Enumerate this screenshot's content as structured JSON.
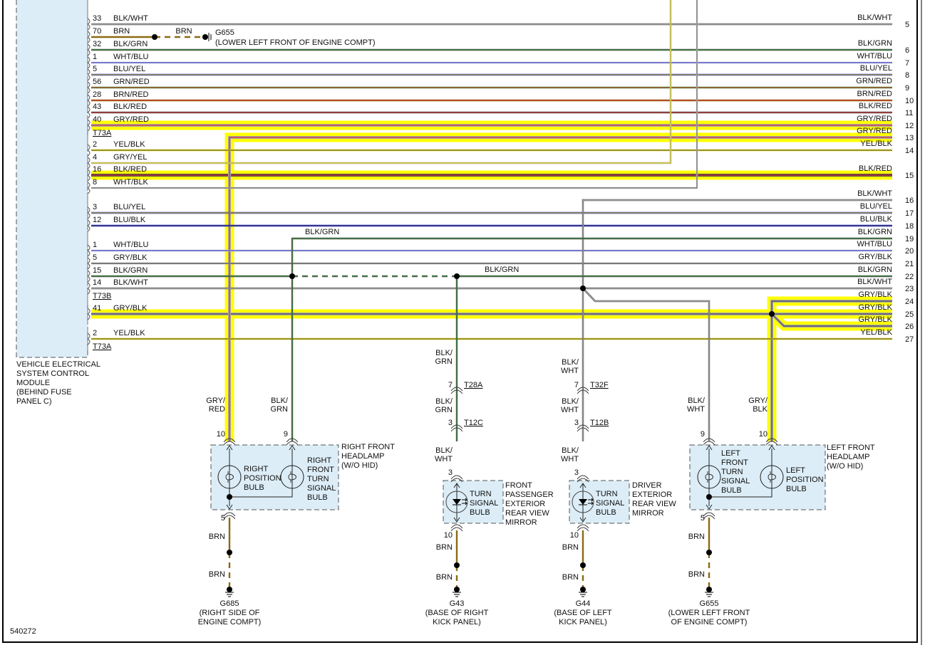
{
  "figure_id": "540272",
  "highlight_color": "#ffff00",
  "wire_colors": {
    "BLK": "#4a4a4a",
    "WHT": "#d0d0d0",
    "BLU": "#2020d0",
    "YEL": "#e6d800",
    "GRN": "#3c9a3c",
    "RED": "#d83030",
    "BRN": "#8b6a14",
    "GRY": "#a8a8a8"
  },
  "module": {
    "name_lines": [
      "VEHICLE ELECTRICAL",
      "SYSTEM CONTROL",
      "MODULE",
      "(BEHIND FUSE",
      "PANEL C)"
    ],
    "connectors": [
      "T73A",
      "T73B",
      "T73A"
    ],
    "pins": [
      {
        "pin": "33",
        "wire": "BLK/WHT"
      },
      {
        "pin": "70",
        "wire": "BRN"
      },
      {
        "pin": "32",
        "wire": "BLK/GRN"
      },
      {
        "pin": "1",
        "wire": "WHT/BLU"
      },
      {
        "pin": "5",
        "wire": "BLU/YEL"
      },
      {
        "pin": "56",
        "wire": "GRN/RED"
      },
      {
        "pin": "28",
        "wire": "BRN/RED"
      },
      {
        "pin": "43",
        "wire": "BLK/RED"
      },
      {
        "pin": "40",
        "wire": "GRY/RED"
      },
      {
        "pin": "2",
        "wire": "YEL/BLK"
      },
      {
        "pin": "4",
        "wire": "GRY/YEL"
      },
      {
        "pin": "16",
        "wire": "BLK/RED"
      },
      {
        "pin": "8",
        "wire": "WHT/BLK"
      },
      {
        "pin": "3",
        "wire": "BLU/YEL"
      },
      {
        "pin": "12",
        "wire": "BLU/BLK"
      },
      {
        "pin": "1",
        "wire": "WHT/BLU"
      },
      {
        "pin": "5",
        "wire": "GRY/BLK"
      },
      {
        "pin": "15",
        "wire": "BLK/GRN"
      },
      {
        "pin": "14",
        "wire": "BLK/WHT"
      },
      {
        "pin": "41",
        "wire": "GRY/BLK"
      },
      {
        "pin": "2",
        "wire": "YEL/BLK"
      }
    ]
  },
  "right_pins": [
    {
      "num": "5",
      "wire": "BLK/WHT"
    },
    {
      "num": "6",
      "wire": "BLK/GRN"
    },
    {
      "num": "7",
      "wire": "WHT/BLU"
    },
    {
      "num": "8",
      "wire": "BLU/YEL"
    },
    {
      "num": "9",
      "wire": "GRN/RED"
    },
    {
      "num": "10",
      "wire": "BRN/RED"
    },
    {
      "num": "11",
      "wire": "BLK/RED"
    },
    {
      "num": "12",
      "wire": "GRY/RED"
    },
    {
      "num": "13",
      "wire": "GRY/RED"
    },
    {
      "num": "14",
      "wire": "YEL/BLK"
    },
    {
      "num": "15",
      "wire": "BLK/RED"
    },
    {
      "num": "16",
      "wire": "BLK/WHT"
    },
    {
      "num": "17",
      "wire": "BLU/YEL"
    },
    {
      "num": "18",
      "wire": "BLU/BLK"
    },
    {
      "num": "19",
      "wire": "BLK/GRN"
    },
    {
      "num": "20",
      "wire": "WHT/BLU"
    },
    {
      "num": "21",
      "wire": "GRY/BLK"
    },
    {
      "num": "22",
      "wire": "BLK/GRN"
    },
    {
      "num": "23",
      "wire": "BLK/WHT"
    },
    {
      "num": "24",
      "wire": "GRY/BLK"
    },
    {
      "num": "25",
      "wire": "GRY/BLK"
    },
    {
      "num": "26",
      "wire": "GRY/BLK"
    },
    {
      "num": "27",
      "wire": "YEL/BLK"
    }
  ],
  "top_ground": {
    "wire": "BRN",
    "id": "G655",
    "location": "(LOWER LEFT FRONT OF ENGINE COMPT)"
  },
  "splice_labels": {
    "blk_grn_19": "BLK/GRN",
    "blk_grn_22": "BLK/GRN"
  },
  "right_headlamp": {
    "title_lines": [
      "RIGHT FRONT",
      "HEADLAMP",
      "(W/O HID)"
    ],
    "bulb1_lines": [
      "RIGHT",
      "POSITION",
      "BULB"
    ],
    "bulb2_lines": [
      "RIGHT",
      "FRONT",
      "TURN",
      "SIGNAL",
      "BULB"
    ],
    "wire1_lines": [
      "GRY/",
      "RED"
    ],
    "wire2_lines": [
      "BLK/",
      "GRN"
    ],
    "pin1": "10",
    "pin2": "9",
    "pin_out": "5",
    "out_wire": "BRN",
    "ground_wire": "BRN",
    "ground_id": "G685",
    "ground_location_lines": [
      "(RIGHT SIDE OF",
      "ENGINE COMPT)"
    ]
  },
  "passenger_mirror": {
    "title_lines": [
      "FRONT",
      "PASSENGER",
      "EXTERIOR",
      "REAR VIEW",
      "MIRROR"
    ],
    "bulb_lines": [
      "TURN",
      "SIGNAL",
      "BULB"
    ],
    "wire_a_lines": [
      "BLK/",
      "GRN"
    ],
    "conn1_pin": "7",
    "conn1": "T28A",
    "wire_b_lines": [
      "BLK/",
      "GRN"
    ],
    "conn2_pin": "3",
    "conn2": "T12C",
    "wire_c_lines": [
      "BLK/",
      "WHT"
    ],
    "pin_in": "3",
    "pin_out": "10",
    "out_wire": "BRN",
    "ground_wire": "BRN",
    "ground_id": "G43",
    "ground_location_lines": [
      "(BASE OF RIGHT",
      "KICK PANEL)"
    ]
  },
  "driver_mirror": {
    "title_lines": [
      "DRIVER",
      "EXTERIOR",
      "REAR VIEW",
      "MIRROR"
    ],
    "bulb_lines": [
      "TURN",
      "SIGNAL",
      "BULB"
    ],
    "wire_a_lines": [
      "BLK/",
      "WHT"
    ],
    "conn1_pin": "7",
    "conn1": "T32F",
    "wire_b_lines": [
      "BLK/",
      "WHT"
    ],
    "conn2_pin": "3",
    "conn2": "T12B",
    "wire_c_lines": [
      "BLK/",
      "WHT"
    ],
    "pin_in": "3",
    "pin_out": "10",
    "out_wire": "BRN",
    "ground_wire": "BRN",
    "ground_id": "G44",
    "ground_location_lines": [
      "(BASE OF LEFT",
      "KICK PANEL)"
    ]
  },
  "left_headlamp": {
    "title_lines": [
      "LEFT FRONT",
      "HEADLAMP",
      "(W/O HID)"
    ],
    "bulb1_lines": [
      "LEFT",
      "FRONT",
      "TURN",
      "SIGNAL",
      "BULB"
    ],
    "bulb2_lines": [
      "LEFT",
      "POSITION",
      "BULB"
    ],
    "wire1_lines": [
      "BLK/",
      "WHT"
    ],
    "wire2_lines": [
      "GRY/",
      "BLK"
    ],
    "pin1": "9",
    "pin2": "10",
    "pin_out": "5",
    "out_wire": "BRN",
    "ground_wire": "BRN",
    "ground_id": "G655",
    "ground_location_lines": [
      "(LOWER LEFT FRONT",
      "OF ENGINE COMPT)"
    ]
  }
}
